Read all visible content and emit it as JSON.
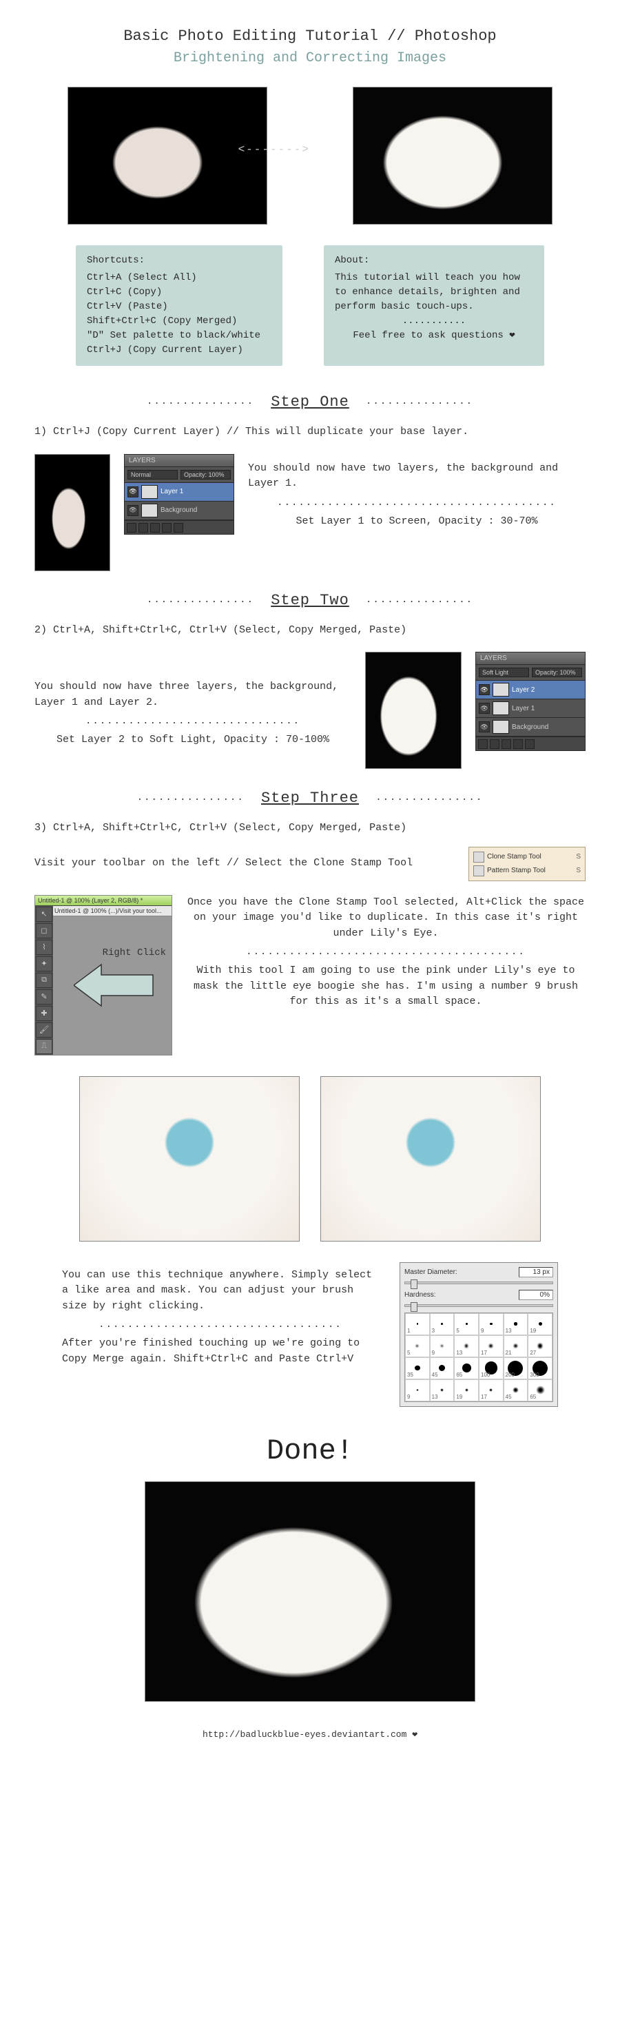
{
  "header": {
    "title1": "Basic Photo Editing Tutorial // Photoshop",
    "title2": "Brightening and Correcting Images",
    "arrow": "<------->"
  },
  "shortcuts": {
    "title": "Shortcuts:",
    "items": [
      "Ctrl+A (Select All)",
      "Ctrl+C (Copy)",
      "Ctrl+V (Paste)",
      "Shift+Ctrl+C (Copy Merged)",
      "\"D\" Set palette to black/white",
      "Ctrl+J (Copy Current Layer)"
    ]
  },
  "about": {
    "title": "About:",
    "body": "This tutorial will teach you how to enhance details, brighten and perform basic touch-ups.",
    "dots": "...........",
    "feel_free": "Feel free to ask questions ❤"
  },
  "dots_long": "...............",
  "step1": {
    "title": "Step One",
    "line1": "1)  Ctrl+J (Copy Current Layer) // This will duplicate your base layer.",
    "text1": "You should now have two layers, the background and Layer 1.",
    "dots": ".......................................",
    "text2": "Set Layer 1 to Screen, Opacity : 30-70%",
    "panel": {
      "tab": "LAYERS",
      "mode": "Normal",
      "opacity": "Opacity: 100%",
      "layer1": "Layer 1",
      "bg": "Background"
    }
  },
  "step2": {
    "title": "Step Two",
    "line1": "2) Ctrl+A, Shift+Ctrl+C, Ctrl+V (Select, Copy Merged, Paste)",
    "text1": "You should now have three layers, the background, Layer 1 and Layer 2.",
    "dots": "..............................",
    "text2": "Set Layer 2 to Soft Light, Opacity : 70-100%",
    "panel": {
      "tab": "LAYERS",
      "mode": "Soft Light",
      "opacity": "Opacity: 100%",
      "layer2": "Layer 2",
      "layer1": "Layer 1",
      "bg": "Background"
    }
  },
  "step3": {
    "title": "Step Three",
    "line1": "3) Ctrl+A, Shift+Ctrl+C, Ctrl+V (Select, Copy Merged, Paste)",
    "line2": "Visit your toolbar on the left // Select the Clone Stamp Tool",
    "context": {
      "clone": "Clone Stamp Tool",
      "pattern": "Pattern Stamp Tool",
      "key": "S"
    },
    "toolbar_title": "Untitled-1 @ 100% (Layer 2, RGB/8) *",
    "toolbar_tab": "Untitled-1 @ 100% (...)/Visit your tool...",
    "right_click": "Right Click",
    "para1": "Once you have the Clone Stamp Tool selected, Alt+Click the space on your image you'd like to duplicate. In this case it's right under Lily's Eye.",
    "dots": ".......................................",
    "para2": "With this tool I am going to use the pink under Lily's eye to mask the little eye boogie she has. I'm using a number 9 brush for this as it's a small space.",
    "para3": "You can use this technique anywhere. Simply select a like area and mask. You can adjust your brush size by right clicking.",
    "dots2": "..................................",
    "para4": "After you're finished touching up we're going to Copy Merge again. Shift+Ctrl+C and Paste Ctrl+V",
    "brush": {
      "master": "Master Diameter:",
      "master_val": "13 px",
      "hardness": "Hardness:",
      "hardness_val": "0%",
      "sizes": [
        "1",
        "3",
        "5",
        "9",
        "13",
        "19",
        "5",
        "9",
        "13",
        "17",
        "21",
        "27",
        "35",
        "45",
        "65",
        "100",
        "200",
        "300",
        "9",
        "13",
        "19",
        "17",
        "45",
        "65"
      ]
    }
  },
  "done": {
    "title": "Done!"
  },
  "footer": {
    "url": "http://badluckblue-eyes.deviantart.com ❤"
  }
}
